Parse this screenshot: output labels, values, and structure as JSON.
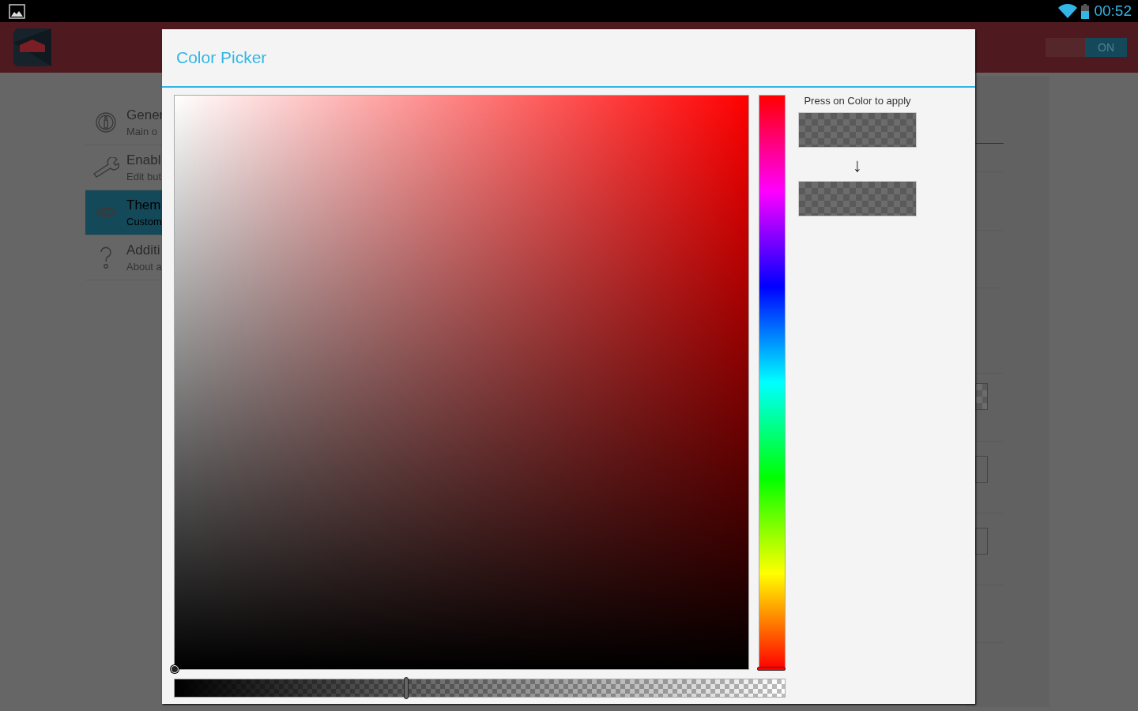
{
  "status_bar": {
    "time": "00:52"
  },
  "app_bar": {
    "toggle": {
      "label": "ON",
      "on": true
    }
  },
  "sidebar": {
    "items": [
      {
        "kind": "info",
        "title": "Gener",
        "subtitle": "Main o",
        "selected": false
      },
      {
        "kind": "wrench",
        "title": "Enabl",
        "subtitle": "Edit but",
        "selected": false
      },
      {
        "kind": "eye",
        "title": "Them",
        "subtitle": "Custom",
        "selected": true
      },
      {
        "kind": "help",
        "title": "Additi",
        "subtitle": "About a",
        "selected": false
      }
    ]
  },
  "dialog": {
    "title": "Color Picker",
    "picker": {
      "sv_square": {
        "saturation": {
          "level": 0
        },
        "value": {
          "level": 0
        }
      },
      "hue_bar": {
        "level": 0
      },
      "alpha_bar": {
        "level": 0.38
      }
    },
    "hint": "Press on Color to apply",
    "arrow": "↓"
  }
}
